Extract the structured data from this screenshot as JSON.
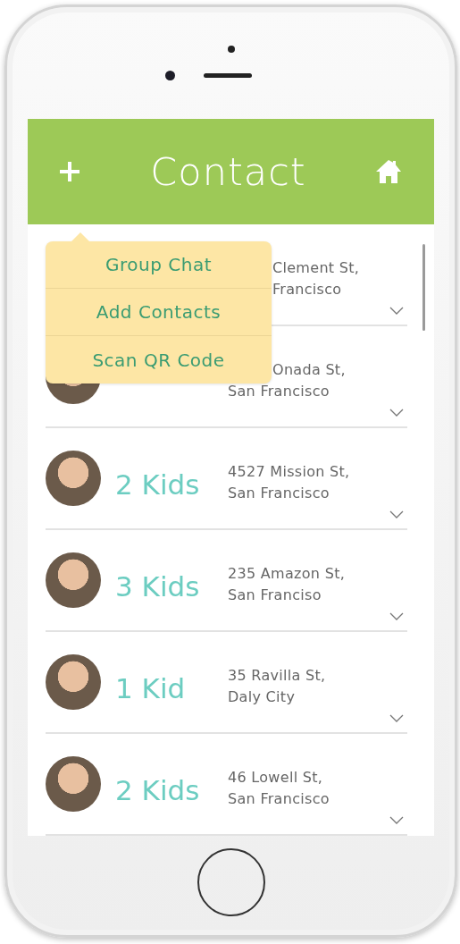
{
  "header": {
    "title": "Contact"
  },
  "menu": {
    "items": [
      {
        "label": "Group Chat"
      },
      {
        "label": "Add Contacts"
      },
      {
        "label": "Scan QR Code"
      }
    ]
  },
  "contacts": [
    {
      "address": [
        "Clement St,",
        "Francisco"
      ]
    },
    {
      "address": [
        "Onada St,",
        "San Francisco"
      ]
    },
    {
      "kids": "2 Kids",
      "address": [
        "4527 Mission St,",
        "San Francisco"
      ]
    },
    {
      "kids": "3 Kids",
      "address": [
        "235 Amazon St,",
        "San Franciso"
      ]
    },
    {
      "kids": "1 Kid",
      "address": [
        "35 Ravilla St,",
        "Daly City"
      ]
    },
    {
      "kids": "2 Kids",
      "address": [
        "46 Lowell St,",
        "San Francisco"
      ]
    }
  ]
}
